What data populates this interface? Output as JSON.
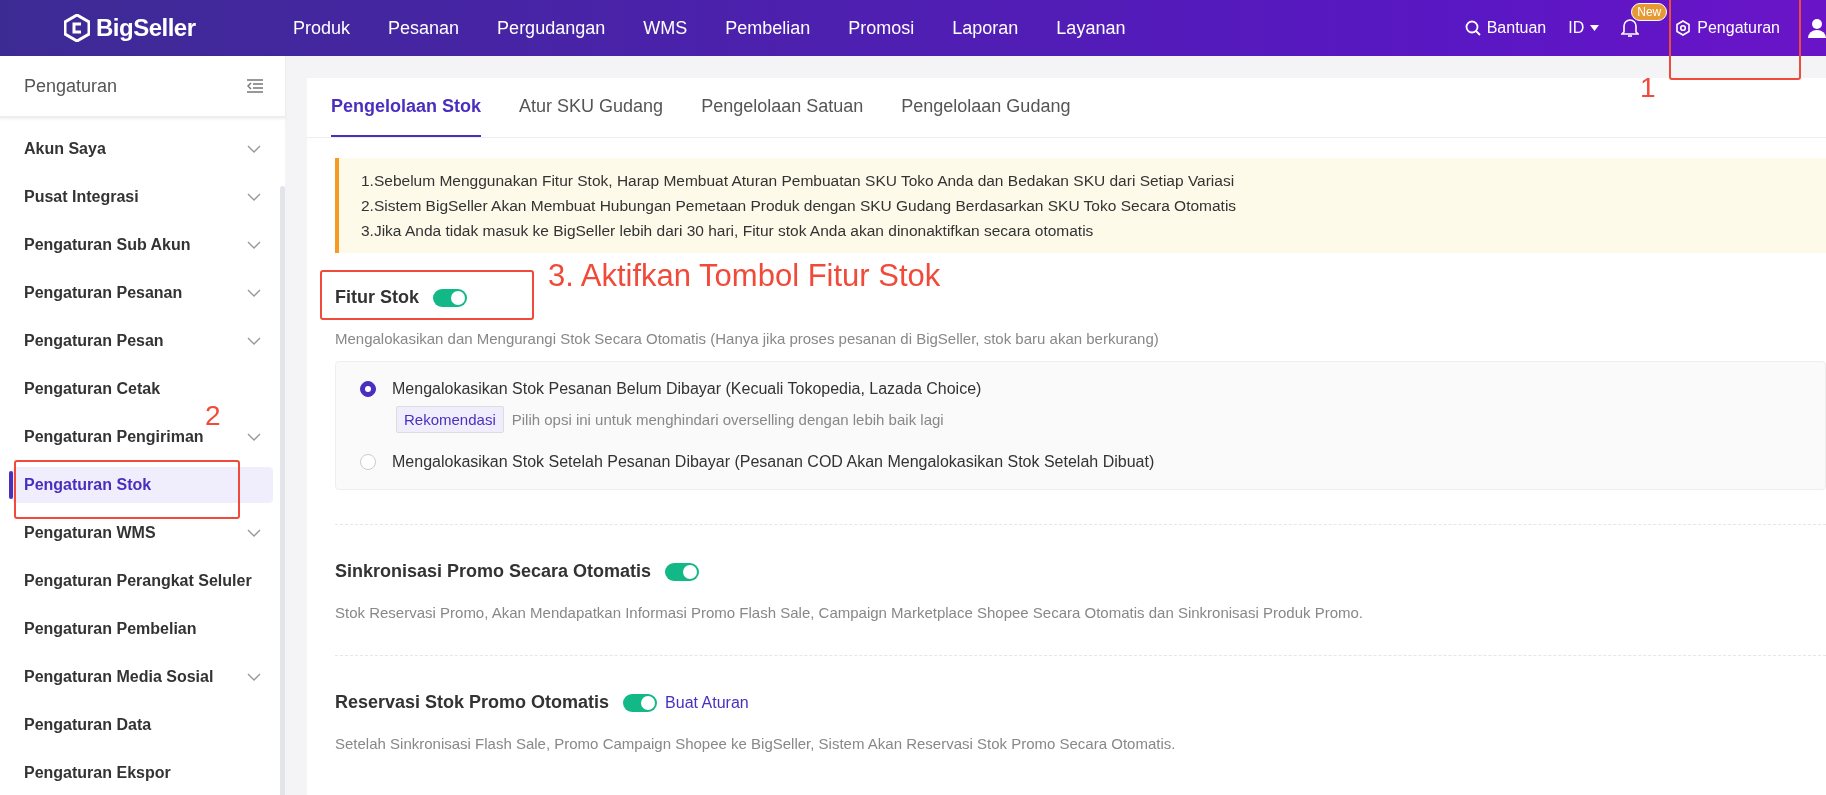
{
  "header": {
    "logo": "BigSeller",
    "nav": [
      "Produk",
      "Pesanan",
      "Pergudangan",
      "WMS",
      "Pembelian",
      "Promosi",
      "Laporan",
      "Layanan"
    ],
    "help": "Bantuan",
    "language": "ID",
    "notification_badge": "New",
    "settings": "Pengaturan"
  },
  "sidebar": {
    "title": "Pengaturan",
    "items": [
      {
        "label": "Akun Saya",
        "expandable": true,
        "selected": false
      },
      {
        "label": "Pusat Integrasi",
        "expandable": true,
        "selected": false
      },
      {
        "label": "Pengaturan Sub Akun",
        "expandable": true,
        "selected": false
      },
      {
        "label": "Pengaturan Pesanan",
        "expandable": true,
        "selected": false
      },
      {
        "label": "Pengaturan Pesan",
        "expandable": true,
        "selected": false
      },
      {
        "label": "Pengaturan Cetak",
        "expandable": false,
        "selected": false
      },
      {
        "label": "Pengaturan Pengiriman",
        "expandable": true,
        "selected": false
      },
      {
        "label": "Pengaturan Stok",
        "expandable": false,
        "selected": true
      },
      {
        "label": "Pengaturan WMS",
        "expandable": true,
        "selected": false
      },
      {
        "label": "Pengaturan Perangkat Seluler",
        "expandable": false,
        "selected": false
      },
      {
        "label": "Pengaturan Pembelian",
        "expandable": false,
        "selected": false
      },
      {
        "label": "Pengaturan Media Sosial",
        "expandable": true,
        "selected": false
      },
      {
        "label": "Pengaturan Data",
        "expandable": false,
        "selected": false
      },
      {
        "label": "Pengaturan Ekspor",
        "expandable": false,
        "selected": false
      }
    ]
  },
  "tabs": [
    {
      "label": "Pengelolaan Stok",
      "selected": true
    },
    {
      "label": "Atur SKU Gudang",
      "selected": false
    },
    {
      "label": "Pengelolaan Satuan",
      "selected": false
    },
    {
      "label": "Pengelolaan Gudang",
      "selected": false
    }
  ],
  "notice": [
    "1.Sebelum Menggunakan Fitur Stok, Harap Membuat Aturan Pembuatan SKU Toko Anda dan Bedakan SKU dari Setiap Variasi",
    "2.Sistem BigSeller Akan Membuat Hubungan Pemetaan Produk dengan SKU Gudang Berdasarkan SKU Toko Secara Otomatis",
    "3.Jika Anda tidak masuk ke BigSeller lebih dari 30 hari, Fitur stok Anda akan dinonaktifkan secara otomatis"
  ],
  "sections": [
    {
      "title": "Fitur Stok",
      "on": true,
      "description": "Mengalokasikan dan Mengurangi Stok Secara Otomatis (Hanya jika proses pesanan di BigSeller, stok baru akan berkurang)",
      "options": [
        {
          "label": "Mengalokasikan Stok Pesanan Belum Dibayar (Kecuali Tokopedia, Lazada Choice)",
          "selected": true,
          "tag": "Rekomendasi",
          "hint": "Pilih opsi ini untuk menghindari overselling dengan lebih baik lagi"
        },
        {
          "label": "Mengalokasikan Stok Setelah Pesanan Dibayar (Pesanan COD Akan Mengalokasikan Stok Setelah Dibuat)",
          "selected": false
        }
      ]
    },
    {
      "title": "Sinkronisasi Promo Secara Otomatis",
      "on": true,
      "description": "Stok Reservasi Promo, Akan Mendapatkan Informasi Promo Flash Sale, Campaign Marketplace Shopee Secara Otomatis dan Sinkronisasi Produk Promo."
    },
    {
      "title": "Reservasi Stok Promo Otomatis",
      "on": true,
      "link": "Buat Aturan",
      "description": "Setelah Sinkronisasi Flash Sale, Promo Campaign Shopee ke BigSeller, Sistem Akan Reservasi Stok Promo Secara Otomatis."
    }
  ],
  "annotations": [
    "1",
    "2",
    "3. Aktifkan Tombol Fitur Stok"
  ]
}
